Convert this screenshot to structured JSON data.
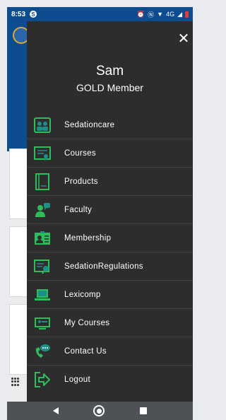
{
  "status_bar": {
    "time": "8:53",
    "app_badge": "S",
    "network": "4G",
    "colors": {
      "bar": "#0d4c8f",
      "battery": "#e23b3b"
    }
  },
  "drawer": {
    "close_icon": "close-icon",
    "user_name": "Sam",
    "membership": "GOLD Member",
    "menu_items": [
      {
        "label": "Sedationcare",
        "icon": "people-icon"
      },
      {
        "label": "Courses",
        "icon": "certificate-icon"
      },
      {
        "label": "Products",
        "icon": "book-icon"
      },
      {
        "label": "Faculty",
        "icon": "faculty-icon"
      },
      {
        "label": "Membership",
        "icon": "id-card-icon"
      },
      {
        "label": "SedationRegulations",
        "icon": "regulations-icon"
      },
      {
        "label": "Lexicomp",
        "icon": "laptop-icon"
      },
      {
        "label": "My Courses",
        "icon": "monitor-user-icon"
      },
      {
        "label": "Contact Us",
        "icon": "phone-chat-icon"
      },
      {
        "label": "Logout",
        "icon": "logout-icon"
      }
    ],
    "colors": {
      "background": "#2d2d2d",
      "icon_green": "#2dbd5a",
      "icon_teal": "#1e8e86"
    }
  },
  "nav_bar": {
    "back_icon": "back-icon",
    "home_icon": "home-icon",
    "recent_icon": "recent-apps-icon"
  }
}
